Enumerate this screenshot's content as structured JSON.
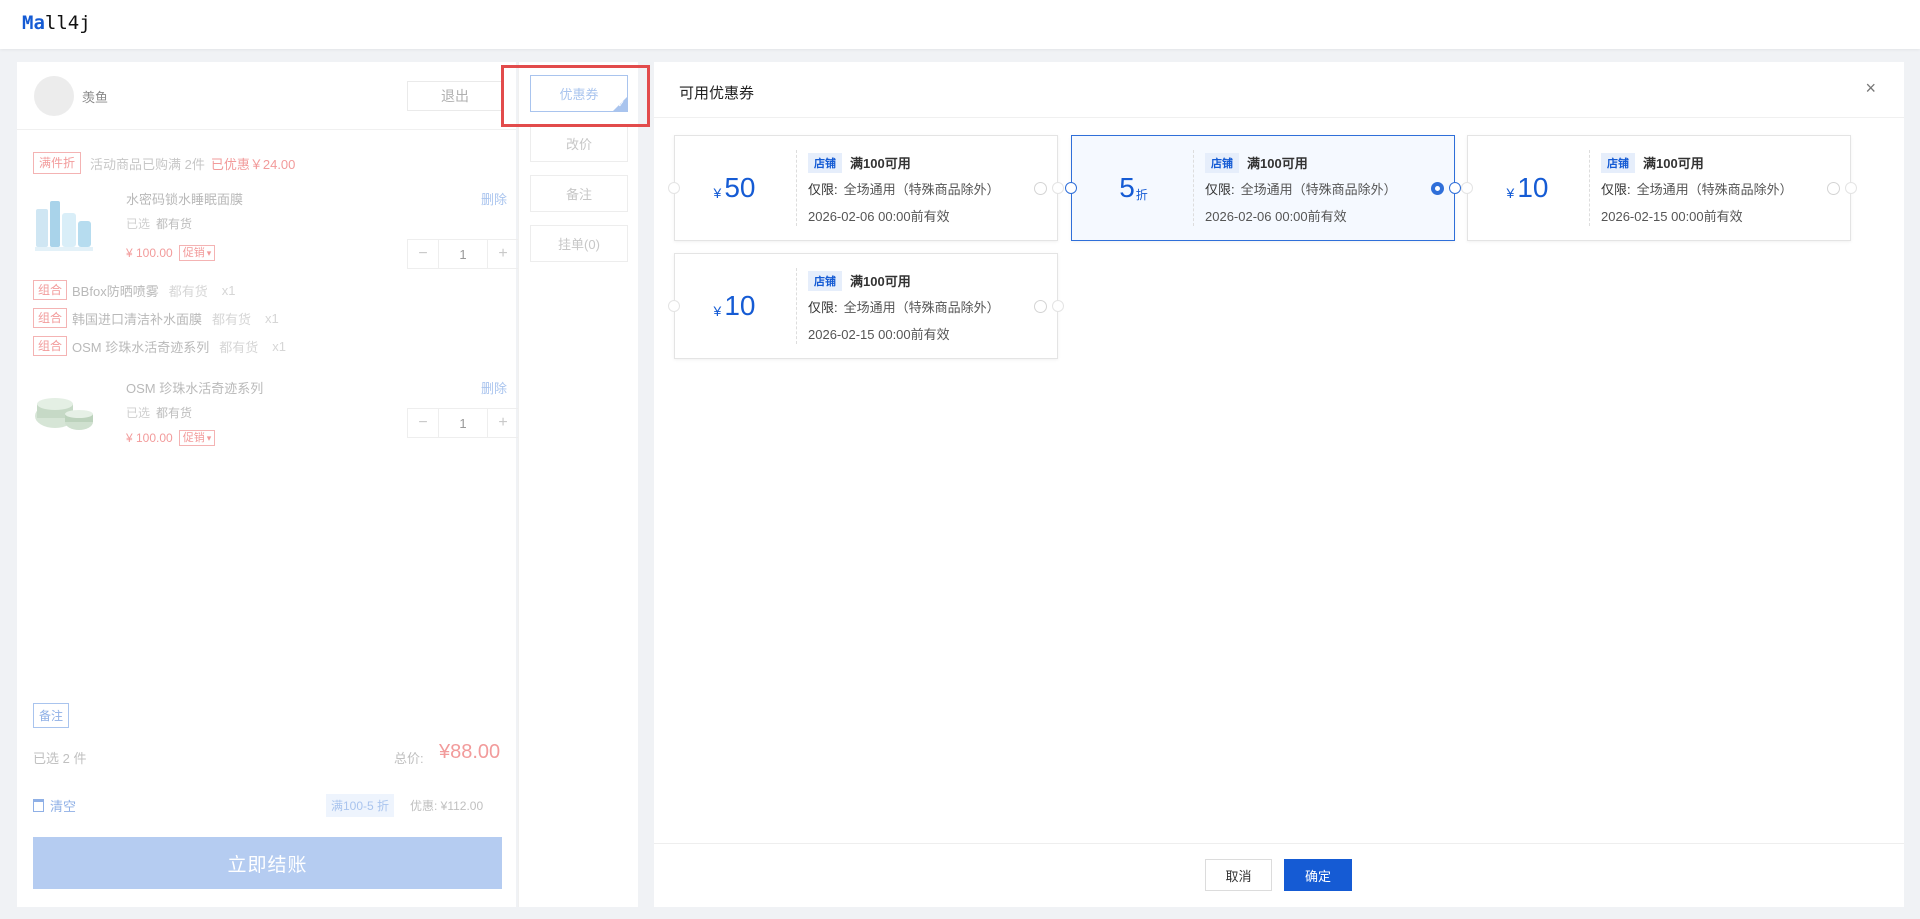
{
  "app": {
    "logo_prefix": "Ma",
    "logo_rest": "ll4j"
  },
  "cart": {
    "user_name": "羡鱼",
    "logout_label": "退出",
    "promo": {
      "tag": "满件折",
      "text": "活动商品已购满 2件",
      "saved": "已优惠￥24.00"
    },
    "items": [
      {
        "name": "水密码锁水睡眠面膜",
        "delete": "删除",
        "selected": "已选",
        "stock": "都有货",
        "price": "¥ 100.00",
        "promo_tag": "促销",
        "qty": "1"
      },
      {
        "name": "OSM 珍珠水活奇迹系列",
        "delete": "删除",
        "selected": "已选",
        "stock": "都有货",
        "price": "¥ 100.00",
        "promo_tag": "促销",
        "qty": "1"
      }
    ],
    "combos": [
      {
        "tag": "组合",
        "name": "BBfox防晒喷雾",
        "stock": "都有货",
        "qty": "x1"
      },
      {
        "tag": "组合",
        "name": "韩国进口清洁补水面膜",
        "stock": "都有货",
        "qty": "x1"
      },
      {
        "tag": "组合",
        "name": "OSM 珍珠水活奇迹系列",
        "stock": "都有货",
        "qty": "x1"
      }
    ],
    "note_tag": "备注",
    "selected_count": "已选 2 件",
    "total_label": "总价:",
    "total_value": "¥88.00",
    "clear_label": "清空",
    "discount_tag": "满100-5 折",
    "discount_amount": "优惠: ¥112.00",
    "checkout_label": "立即结账"
  },
  "actions": {
    "coupon": "优惠券",
    "reprice": "改价",
    "note": "备注",
    "hold": "挂单(0)"
  },
  "dialog": {
    "title": "可用优惠券",
    "close": "×",
    "cancel": "取消",
    "confirm": "确定",
    "coupons": [
      {
        "currency": "¥",
        "amount": "50",
        "unit": "",
        "shop_tag": "店铺",
        "condition": "满100可用",
        "scope_label": "仅限:",
        "scope": "全场通用（特殊商品除外）",
        "validity": "2026-02-06 00:00前有效",
        "selected": false
      },
      {
        "currency": "",
        "amount": "5",
        "unit": "折",
        "shop_tag": "店铺",
        "condition": "满100可用",
        "scope_label": "仅限:",
        "scope": "全场通用（特殊商品除外）",
        "validity": "2026-02-06 00:00前有效",
        "selected": true
      },
      {
        "currency": "¥",
        "amount": "10",
        "unit": "",
        "shop_tag": "店铺",
        "condition": "满100可用",
        "scope_label": "仅限:",
        "scope": "全场通用（特殊商品除外）",
        "validity": "2026-02-15 00:00前有效",
        "selected": false
      },
      {
        "currency": "¥",
        "amount": "10",
        "unit": "",
        "shop_tag": "店铺",
        "condition": "满100可用",
        "scope_label": "仅限:",
        "scope": "全场通用（特殊商品除外）",
        "validity": "2026-02-15 00:00前有效",
        "selected": false
      }
    ]
  },
  "colors": {
    "primary": "#155bd4",
    "highlight": "#e24b4b",
    "promo_red": "#f29b9b"
  }
}
